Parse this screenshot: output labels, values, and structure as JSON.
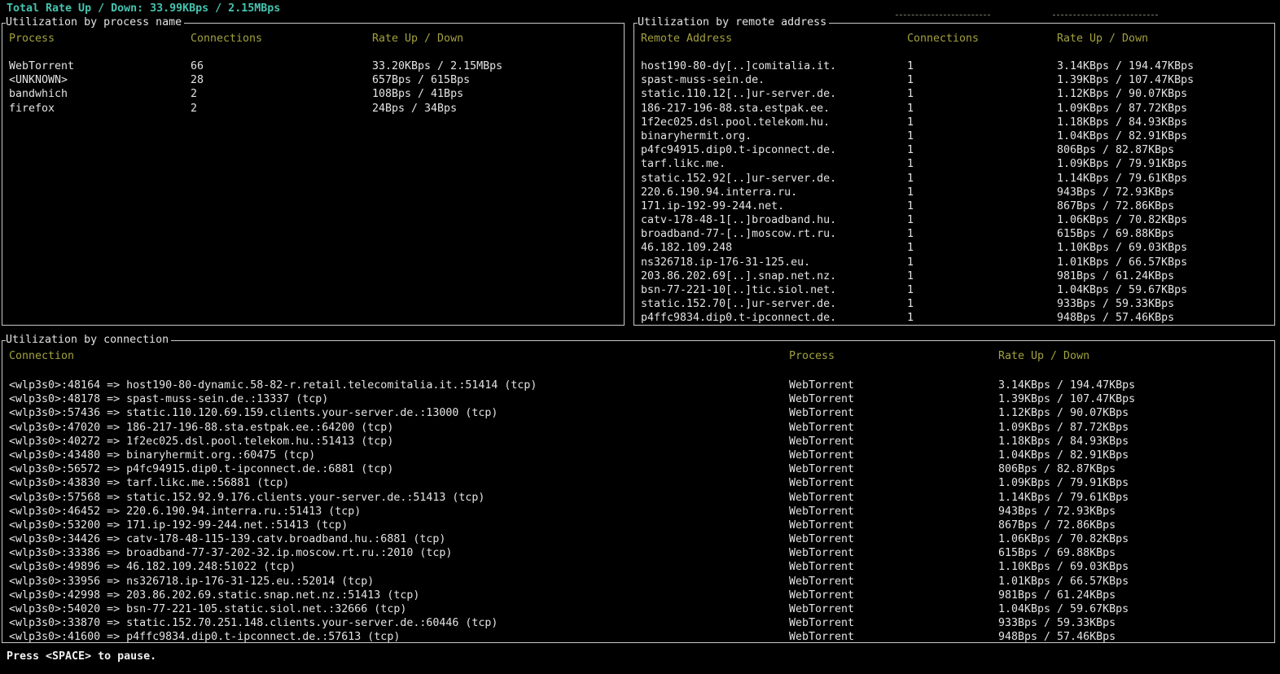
{
  "app": {
    "total_rate": "Total Rate Up / Down: 33.99KBps / 2.15MBps",
    "footer_hint": "Press <SPACE> to pause."
  },
  "colors": {
    "background": "#000000",
    "text": "#e4e4e4",
    "accent_teal": "#46c3af",
    "header_olive": "#a3a13f",
    "panel_border": "#c9c9c9"
  },
  "process_panel": {
    "title": "Utilization by process name",
    "columns": {
      "process": "Process",
      "connections": "Connections",
      "rate": "Rate Up / Down"
    },
    "rows": [
      {
        "process": "WebTorrent",
        "connections": "66",
        "rate": "33.20KBps / 2.15MBps"
      },
      {
        "process": "<UNKNOWN>",
        "connections": "28",
        "rate": "657Bps / 615Bps"
      },
      {
        "process": "bandwhich",
        "connections": "2",
        "rate": "108Bps / 41Bps"
      },
      {
        "process": "firefox",
        "connections": "2",
        "rate": "24Bps / 34Bps"
      }
    ]
  },
  "remote_panel": {
    "title": "Utilization by remote address",
    "columns": {
      "address": "Remote Address",
      "connections": "Connections",
      "rate": "Rate Up / Down"
    },
    "rows": [
      {
        "address": "host190-80-dy[..]comitalia.it.",
        "connections": "1",
        "rate": "3.14KBps / 194.47KBps"
      },
      {
        "address": "spast-muss-sein.de.",
        "connections": "1",
        "rate": "1.39KBps / 107.47KBps"
      },
      {
        "address": "static.110.12[..]ur-server.de.",
        "connections": "1",
        "rate": "1.12KBps / 90.07KBps"
      },
      {
        "address": "186-217-196-88.sta.estpak.ee.",
        "connections": "1",
        "rate": "1.09KBps / 87.72KBps"
      },
      {
        "address": "1f2ec025.dsl.pool.telekom.hu.",
        "connections": "1",
        "rate": "1.18KBps / 84.93KBps"
      },
      {
        "address": "binaryhermit.org.",
        "connections": "1",
        "rate": "1.04KBps / 82.91KBps"
      },
      {
        "address": "p4fc94915.dip0.t-ipconnect.de.",
        "connections": "1",
        "rate": "806Bps / 82.87KBps"
      },
      {
        "address": "tarf.likc.me.",
        "connections": "1",
        "rate": "1.09KBps / 79.91KBps"
      },
      {
        "address": "static.152.92[..]ur-server.de.",
        "connections": "1",
        "rate": "1.14KBps / 79.61KBps"
      },
      {
        "address": "220.6.190.94.interra.ru.",
        "connections": "1",
        "rate": "943Bps / 72.93KBps"
      },
      {
        "address": "171.ip-192-99-244.net.",
        "connections": "1",
        "rate": "867Bps / 72.86KBps"
      },
      {
        "address": "catv-178-48-1[..]broadband.hu.",
        "connections": "1",
        "rate": "1.06KBps / 70.82KBps"
      },
      {
        "address": "broadband-77-[..]moscow.rt.ru.",
        "connections": "1",
        "rate": "615Bps / 69.88KBps"
      },
      {
        "address": "46.182.109.248",
        "connections": "1",
        "rate": "1.10KBps / 69.03KBps"
      },
      {
        "address": "ns326718.ip-176-31-125.eu.",
        "connections": "1",
        "rate": "1.01KBps / 66.57KBps"
      },
      {
        "address": "203.86.202.69[..].snap.net.nz.",
        "connections": "1",
        "rate": "981Bps / 61.24KBps"
      },
      {
        "address": "bsn-77-221-10[..]tic.siol.net.",
        "connections": "1",
        "rate": "1.04KBps / 59.67KBps"
      },
      {
        "address": "static.152.70[..]ur-server.de.",
        "connections": "1",
        "rate": "933Bps / 59.33KBps"
      },
      {
        "address": "p4ffc9834.dip0.t-ipconnect.de.",
        "connections": "1",
        "rate": "948Bps / 57.46KBps"
      }
    ]
  },
  "connection_panel": {
    "title": "Utilization by connection",
    "columns": {
      "connection": "Connection",
      "process": "Process",
      "rate": "Rate Up / Down"
    },
    "rows": [
      {
        "connection": "<wlp3s0>:48164 => host190-80-dynamic.58-82-r.retail.telecomitalia.it.:51414 (tcp)",
        "process": "WebTorrent",
        "rate": "3.14KBps / 194.47KBps"
      },
      {
        "connection": "<wlp3s0>:48178 => spast-muss-sein.de.:13337 (tcp)",
        "process": "WebTorrent",
        "rate": "1.39KBps / 107.47KBps"
      },
      {
        "connection": "<wlp3s0>:57436 => static.110.120.69.159.clients.your-server.de.:13000 (tcp)",
        "process": "WebTorrent",
        "rate": "1.12KBps / 90.07KBps"
      },
      {
        "connection": "<wlp3s0>:47020 => 186-217-196-88.sta.estpak.ee.:64200 (tcp)",
        "process": "WebTorrent",
        "rate": "1.09KBps / 87.72KBps"
      },
      {
        "connection": "<wlp3s0>:40272 => 1f2ec025.dsl.pool.telekom.hu.:51413 (tcp)",
        "process": "WebTorrent",
        "rate": "1.18KBps / 84.93KBps"
      },
      {
        "connection": "<wlp3s0>:43480 => binaryhermit.org.:60475 (tcp)",
        "process": "WebTorrent",
        "rate": "1.04KBps / 82.91KBps"
      },
      {
        "connection": "<wlp3s0>:56572 => p4fc94915.dip0.t-ipconnect.de.:6881 (tcp)",
        "process": "WebTorrent",
        "rate": "806Bps / 82.87KBps"
      },
      {
        "connection": "<wlp3s0>:43830 => tarf.likc.me.:56881 (tcp)",
        "process": "WebTorrent",
        "rate": "1.09KBps / 79.91KBps"
      },
      {
        "connection": "<wlp3s0>:57568 => static.152.92.9.176.clients.your-server.de.:51413 (tcp)",
        "process": "WebTorrent",
        "rate": "1.14KBps / 79.61KBps"
      },
      {
        "connection": "<wlp3s0>:46452 => 220.6.190.94.interra.ru.:51413 (tcp)",
        "process": "WebTorrent",
        "rate": "943Bps / 72.93KBps"
      },
      {
        "connection": "<wlp3s0>:53200 => 171.ip-192-99-244.net.:51413 (tcp)",
        "process": "WebTorrent",
        "rate": "867Bps / 72.86KBps"
      },
      {
        "connection": "<wlp3s0>:34426 => catv-178-48-115-139.catv.broadband.hu.:6881 (tcp)",
        "process": "WebTorrent",
        "rate": "1.06KBps / 70.82KBps"
      },
      {
        "connection": "<wlp3s0>:33386 => broadband-77-37-202-32.ip.moscow.rt.ru.:2010 (tcp)",
        "process": "WebTorrent",
        "rate": "615Bps / 69.88KBps"
      },
      {
        "connection": "<wlp3s0>:49896 => 46.182.109.248:51022 (tcp)",
        "process": "WebTorrent",
        "rate": "1.10KBps / 69.03KBps"
      },
      {
        "connection": "<wlp3s0>:33956 => ns326718.ip-176-31-125.eu.:52014 (tcp)",
        "process": "WebTorrent",
        "rate": "1.01KBps / 66.57KBps"
      },
      {
        "connection": "<wlp3s0>:42998 => 203.86.202.69.static.snap.net.nz.:51413 (tcp)",
        "process": "WebTorrent",
        "rate": "981Bps / 61.24KBps"
      },
      {
        "connection": "<wlp3s0>:54020 => bsn-77-221-105.static.siol.net.:32666 (tcp)",
        "process": "WebTorrent",
        "rate": "1.04KBps / 59.67KBps"
      },
      {
        "connection": "<wlp3s0>:33870 => static.152.70.251.148.clients.your-server.de.:60446 (tcp)",
        "process": "WebTorrent",
        "rate": "933Bps / 59.33KBps"
      },
      {
        "connection": "<wlp3s0>:41600 => p4ffc9834.dip0.t-ipconnect.de.:57613 (tcp)",
        "process": "WebTorrent",
        "rate": "948Bps / 57.46KBps"
      }
    ]
  }
}
